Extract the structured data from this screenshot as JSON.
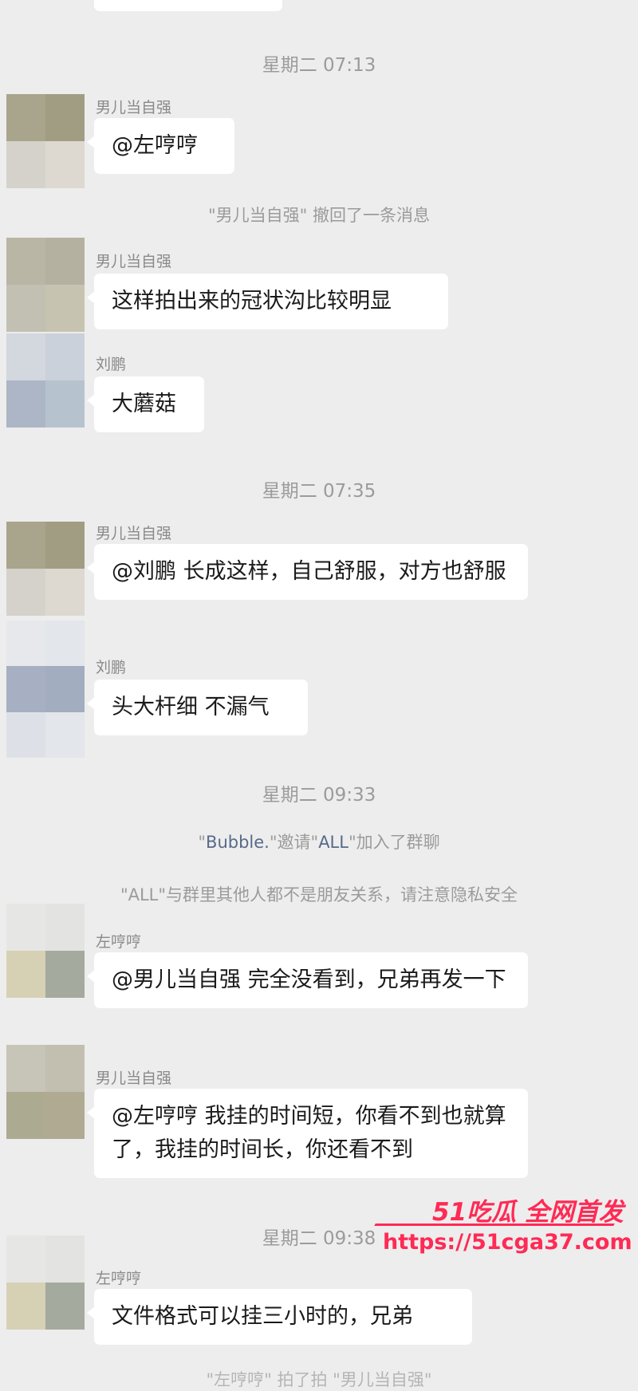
{
  "timestamps": [
    "星期二 07:13",
    "星期二 07:35",
    "星期二 09:33",
    "星期二 09:38"
  ],
  "recall_notice": "\"男儿当自强\" 撤回了一条消息",
  "invite_notice": {
    "q1": "\"",
    "inviter": "Bubble.",
    "mid": "\"邀请\"",
    "invitee": "ALL",
    "end": "\"加入了群聊"
  },
  "privacy_notice": "\"ALL\"与群里其他人都不是朋友关系，请注意隐私安全",
  "messages": [
    {
      "sender": "男儿当自强",
      "text": "@左哼哼"
    },
    {
      "sender": "男儿当自强",
      "text": "这样拍出来的冠状沟比较明显"
    },
    {
      "sender": "刘鹏",
      "text": "大蘑菇"
    },
    {
      "sender": "男儿当自强",
      "text": "@刘鹏 长成这样，自己舒服，对方也舒服"
    },
    {
      "sender": "刘鹏",
      "text": "头大杆细 不漏气"
    },
    {
      "sender": "左哼哼",
      "text": "@男儿当自强 完全没看到，兄弟再发一下"
    },
    {
      "sender": "男儿当自强",
      "text": "@左哼哼 我挂的时间短，你看不到也就算了，我挂的时间长，你还看不到"
    },
    {
      "sender": "左哼哼",
      "text": "文件格式可以挂三小时的，兄弟"
    }
  ],
  "bottom_partial": "\"左哼哼\" 拍了拍 \"男儿当自强\"",
  "watermark": {
    "brand": "51吃瓜 全网首发",
    "url": "https://51cga37.com"
  },
  "colors": {
    "background": "#ededed",
    "bubble": "#ffffff",
    "name_link": "#586a8a",
    "watermark": "#ff2a55"
  }
}
